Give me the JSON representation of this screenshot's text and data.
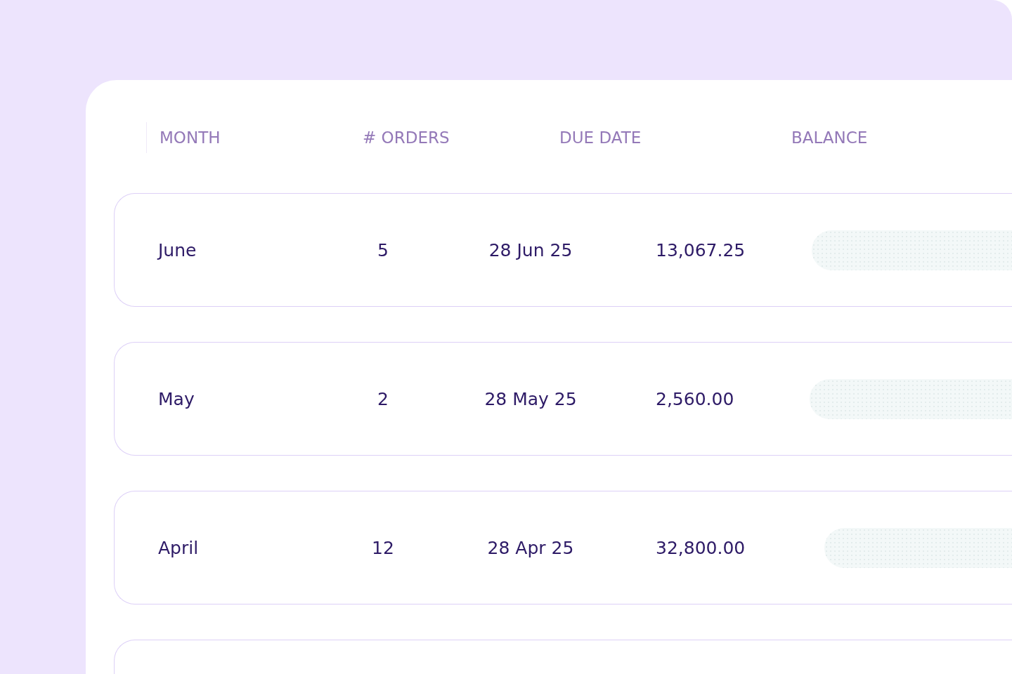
{
  "table": {
    "columns": [
      "MONTH",
      "# ORDERS",
      "DUE DATE",
      "BALANCE"
    ],
    "rows": [
      {
        "month": "June",
        "orders": "5",
        "due_date": "28 Jun 25",
        "balance": "13,067.25"
      },
      {
        "month": "May",
        "orders": "2",
        "due_date": "28 May 25",
        "balance": "2,560.00"
      },
      {
        "month": "April",
        "orders": "12",
        "due_date": "28 Apr 25",
        "balance": "32,800.00"
      }
    ]
  }
}
